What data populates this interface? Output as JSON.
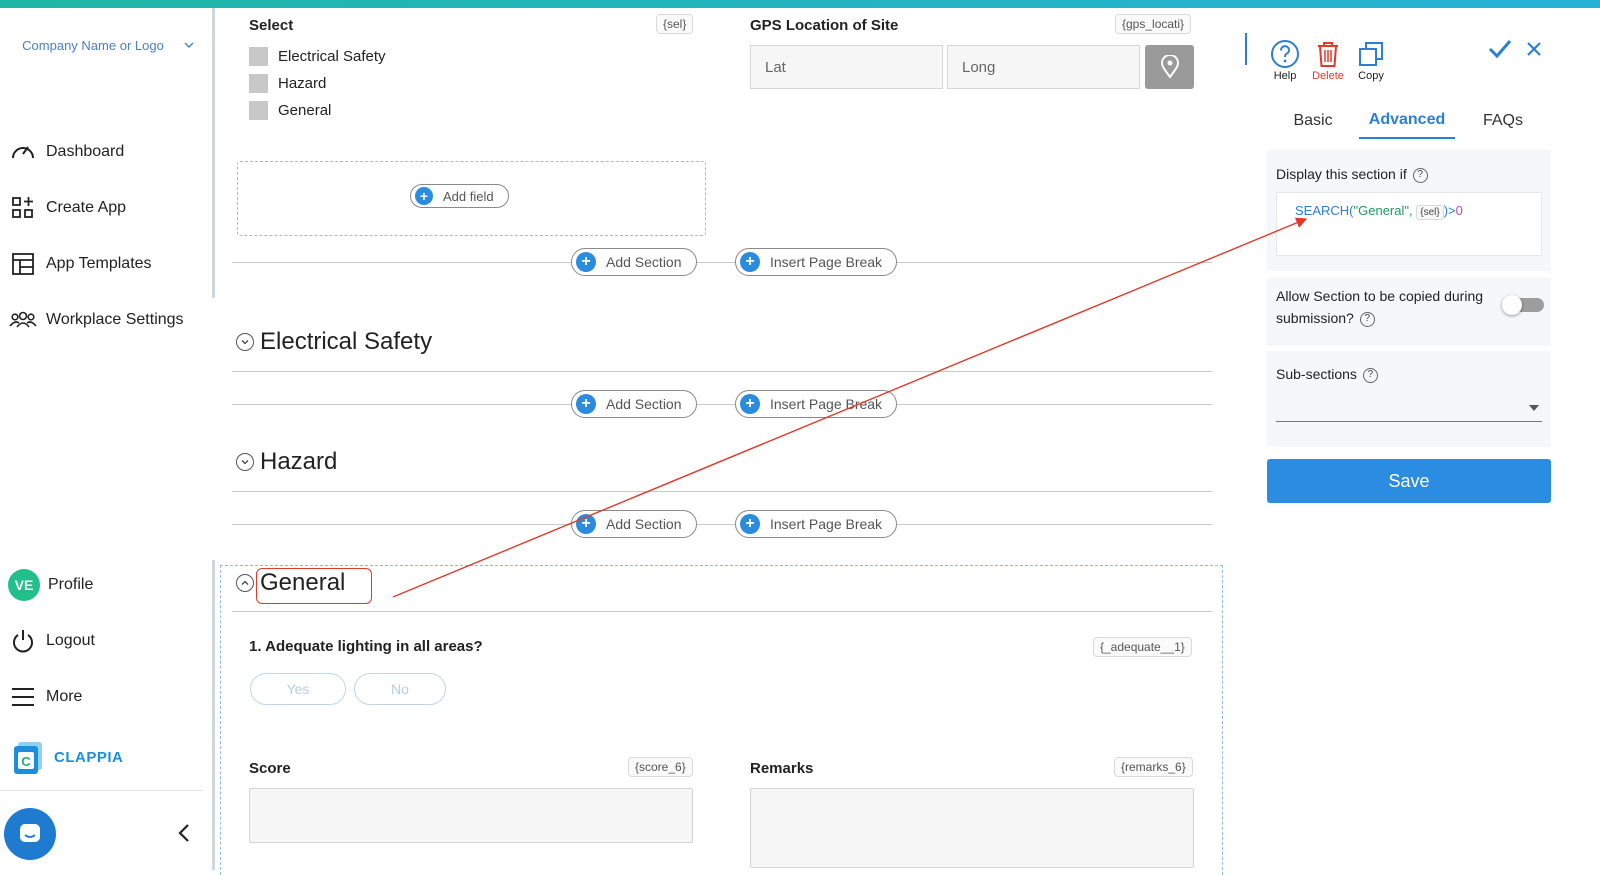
{
  "sidebar": {
    "company": "Company Name or Logo",
    "nav": [
      {
        "label": "Dashboard"
      },
      {
        "label": "Create App"
      },
      {
        "label": "App Templates"
      },
      {
        "label": "Workplace Settings"
      }
    ],
    "profile": {
      "initials": "VE",
      "label": "Profile"
    },
    "logout": "Logout",
    "more": "More",
    "brand": "CLAPPIA"
  },
  "form": {
    "select_field": {
      "title": "Select",
      "var": "{sel}",
      "options": [
        "Electrical Safety",
        "Hazard",
        "General"
      ]
    },
    "gps_field": {
      "title": "GPS Location of Site",
      "var": "{gps_locati}",
      "lat_placeholder": "Lat",
      "long_placeholder": "Long"
    },
    "add_field": "Add field",
    "add_section": "Add Section",
    "insert_page_break": "Insert Page Break",
    "sections": [
      "Electrical Safety",
      "Hazard",
      "General"
    ],
    "question": {
      "title": "1. Adequate lighting in all areas?",
      "var": "{_adequate__1}",
      "yes": "Yes",
      "no": "No"
    },
    "score": {
      "title": "Score",
      "var": "{score_6}"
    },
    "remarks": {
      "title": "Remarks",
      "var": "{remarks_6}"
    }
  },
  "panel": {
    "tools": {
      "help": "Help",
      "delete": "Delete",
      "copy": "Copy"
    },
    "tabs": [
      "Basic",
      "Advanced",
      "FAQs"
    ],
    "active_tab": "Advanced",
    "display_if": {
      "label": "Display this section if",
      "formula_fn": "SEARCH(",
      "formula_str": "\"General\",",
      "formula_tag": "{sel}",
      "formula_close": ")>",
      "formula_num": "0"
    },
    "allow_copy": {
      "label": "Allow Section to be copied during submission?",
      "enabled": false
    },
    "subsections": {
      "label": "Sub-sections"
    },
    "save": "Save"
  },
  "colors": {
    "accent": "#2b8de1",
    "annotation": "#e03a2c",
    "brand": "#1c8fdc"
  }
}
